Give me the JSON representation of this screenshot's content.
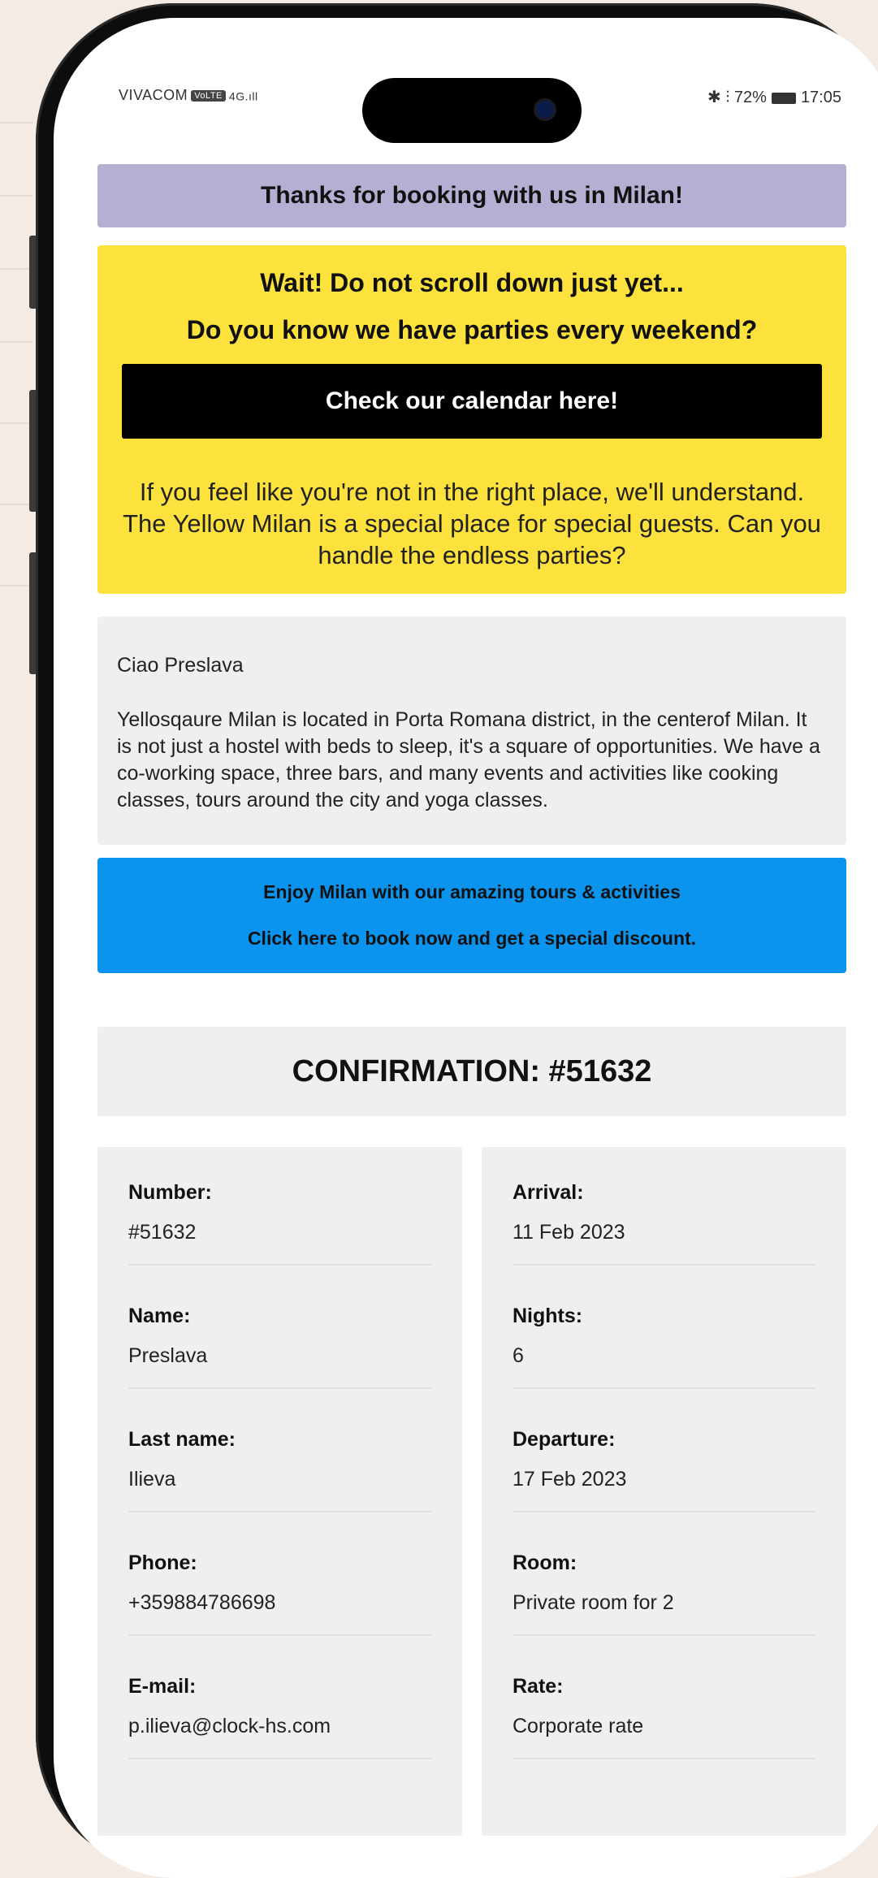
{
  "status_bar": {
    "carrier": "VIVACOM",
    "carrier_badge": "VoLTE",
    "signal": "4G",
    "right": "✱ ⫶ 72%",
    "time": "17:05"
  },
  "banner": {
    "thanks": "Thanks for booking with us in Milan!"
  },
  "promo": {
    "line1": "Wait! Do not scroll down just yet...",
    "line2": "Do you know we have parties every weekend?",
    "button": "Check our calendar here!",
    "paragraph": "If you feel like you're not in the right place, we'll understand. The Yellow Milan is a special place for special guests. Can you handle the endless parties?"
  },
  "message": {
    "greeting": "Ciao Preslava",
    "body": "Yellosqaure Milan is located in Porta Romana district, in the centerof Milan. It is not just a hostel with beds to sleep, it's a square of opportunities. We have a co-working space, three bars, and many events and activities like cooking classes, tours around the city and yoga classes."
  },
  "tours": {
    "line1": "Enjoy Milan with our amazing tours & activities",
    "line2": "Click here to book now and get a special discount."
  },
  "confirmation": {
    "title": "CONFIRMATION: #51632",
    "left": [
      {
        "label": "Number:",
        "value": "#51632"
      },
      {
        "label": "Name:",
        "value": "Preslava"
      },
      {
        "label": "Last name:",
        "value": "Ilieva"
      },
      {
        "label": "Phone:",
        "value": "+359884786698"
      },
      {
        "label": "E-mail:",
        "value": "p.ilieva@clock-hs.com"
      }
    ],
    "right": [
      {
        "label": "Arrival:",
        "value": "11 Feb 2023"
      },
      {
        "label": "Nights:",
        "value": "6"
      },
      {
        "label": "Departure:",
        "value": "17 Feb 2023"
      },
      {
        "label": "Room:",
        "value": "Private room for 2"
      },
      {
        "label": "Rate:",
        "value": "Corporate rate"
      }
    ]
  },
  "colors": {
    "background": "#f3ebe4",
    "thanks_banner": "#b7aed3",
    "promo_yellow": "#fde13d",
    "tours_blue": "#0a94ee",
    "panel_grey": "#efefef"
  }
}
